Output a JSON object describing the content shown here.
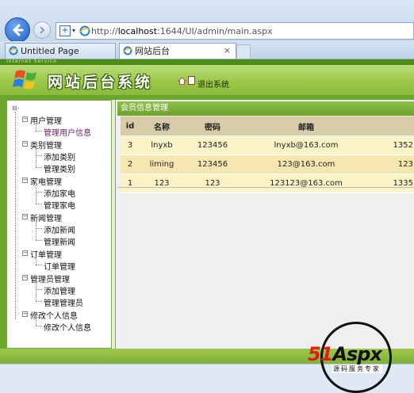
{
  "browser": {
    "url_prefix": "http://",
    "url_host": "localhost",
    "url_path": ":1644/UI/admin/main.aspx",
    "tabs": [
      {
        "label": "Untitled Page"
      },
      {
        "label": "网站后台",
        "close": "×"
      }
    ]
  },
  "header": {
    "tagline": "Internet Service",
    "title": "网站后台系统",
    "exit_label": "退出系统",
    "brand_color": "#6aa52c"
  },
  "sidebar": {
    "root": "⊟-",
    "groups": [
      {
        "label": "用户管理",
        "items": [
          "管理用户信息"
        ]
      },
      {
        "label": "类别管理",
        "items": [
          "添加类别",
          "管理类别"
        ]
      },
      {
        "label": "家电管理",
        "items": [
          "添加家电",
          "管理家电"
        ]
      },
      {
        "label": "新闻管理",
        "items": [
          "添加新闻",
          "管理新闻"
        ]
      },
      {
        "label": "订单管理",
        "items": [
          "订单管理"
        ]
      },
      {
        "label": "管理员管理",
        "items": [
          "添加管理",
          "管理管理员"
        ]
      },
      {
        "label": "修改个人信息",
        "items": [
          "修改个人信息"
        ]
      }
    ]
  },
  "panel": {
    "title": "会员信息管理",
    "columns": [
      "id",
      "名称",
      "密码",
      "邮箱",
      ""
    ],
    "rows": [
      [
        "3",
        "lnyxb",
        "123456",
        "lnyxb@163.com",
        "1352"
      ],
      [
        "2",
        "liming",
        "123456",
        "123@163.com",
        "123"
      ],
      [
        "1",
        "123",
        "123",
        "123123@163.com",
        "1335"
      ]
    ]
  },
  "watermark": {
    "brand_red": "51",
    "brand_black": "Aspx",
    "subtitle": "源码服务专家"
  }
}
